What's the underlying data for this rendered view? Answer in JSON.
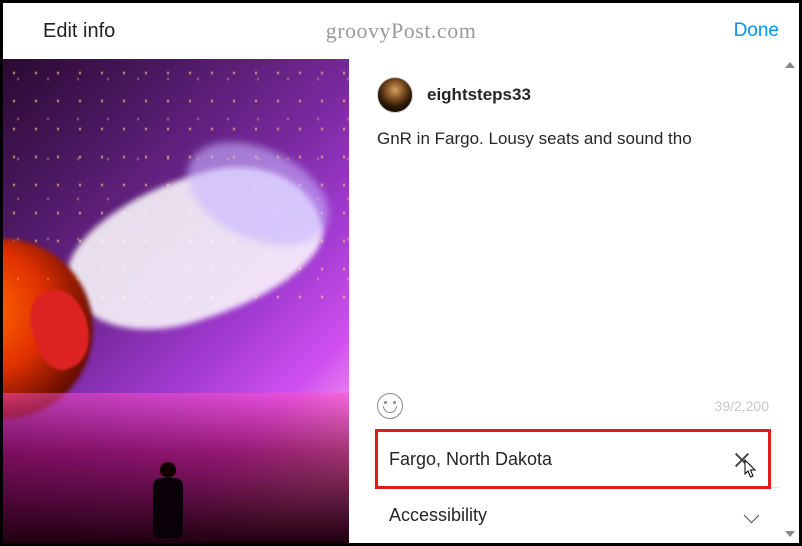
{
  "header": {
    "title": "Edit info",
    "watermark": "groovyPost.com",
    "done_label": "Done"
  },
  "post": {
    "username": "eightsteps33",
    "caption": "GnR in Fargo. Lousy seats and sound tho",
    "char_counter": "39/2,200"
  },
  "rows": {
    "location_label": "Fargo, North Dakota",
    "accessibility_label": "Accessibility"
  }
}
